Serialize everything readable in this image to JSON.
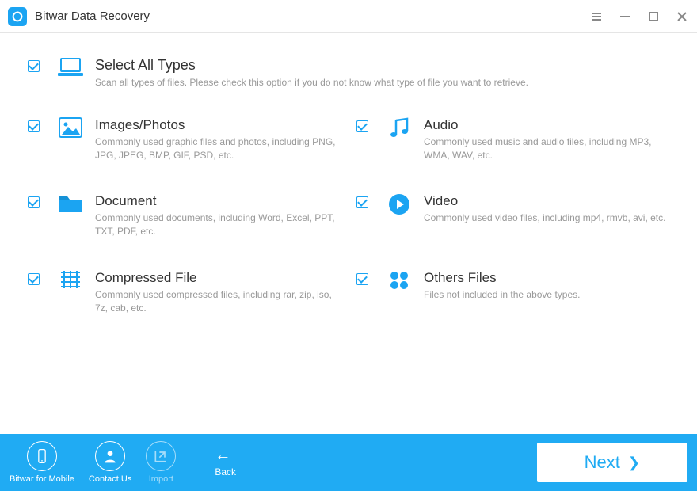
{
  "app": {
    "title": "Bitwar Data Recovery"
  },
  "selectAll": {
    "title": "Select All Types",
    "desc": "Scan all types of files. Please check this option if you do not know what type of file you want to retrieve."
  },
  "types": {
    "images": {
      "title": "Images/Photos",
      "desc": "Commonly used graphic files and photos, including PNG, JPG, JPEG, BMP, GIF, PSD, etc."
    },
    "audio": {
      "title": "Audio",
      "desc": "Commonly used music and audio files, including MP3, WMA, WAV, etc."
    },
    "document": {
      "title": "Document",
      "desc": "Commonly used documents, including Word, Excel, PPT, TXT, PDF, etc."
    },
    "video": {
      "title": "Video",
      "desc": "Commonly used video files, including mp4, rmvb, avi, etc."
    },
    "compressed": {
      "title": "Compressed File",
      "desc": "Commonly used compressed files, including rar, zip, iso, 7z, cab, etc."
    },
    "others": {
      "title": "Others Files",
      "desc": "Files not included in the above types."
    }
  },
  "footer": {
    "mobile": "Bitwar for Mobile",
    "contact": "Contact Us",
    "import": "Import",
    "back": "Back",
    "next": "Next"
  },
  "colors": {
    "accent": "#20abf3",
    "blue": "#1ba4f2"
  }
}
